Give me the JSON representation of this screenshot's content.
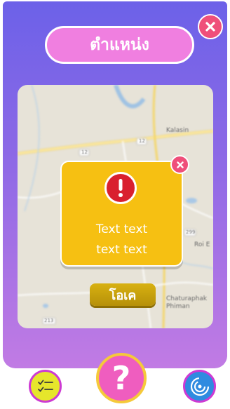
{
  "header": {
    "title": "ตำแหน่ง"
  },
  "map": {
    "labels": [
      "Kalasin",
      "12",
      "12",
      "299",
      "Roi E",
      "Chaturaphak Phiman",
      "213"
    ]
  },
  "alert": {
    "icon": "exclamation-icon",
    "line1": "Text text",
    "line2": "text text",
    "ok_label": "โอเค"
  },
  "bottom_nav": {
    "items": [
      {
        "icon": "checklist-icon"
      },
      {
        "icon": "question-mark-icon",
        "label": "?"
      },
      {
        "icon": "radar-icon"
      }
    ]
  },
  "colors": {
    "panel_top": "#6c61e8",
    "panel_bottom": "#c17be4",
    "title_pill": "#f07fe0",
    "close": "#ef4f7a",
    "alert_bg": "#f6c012",
    "alert_icon": "#d9202f",
    "ok_button": "#c9a20d"
  }
}
